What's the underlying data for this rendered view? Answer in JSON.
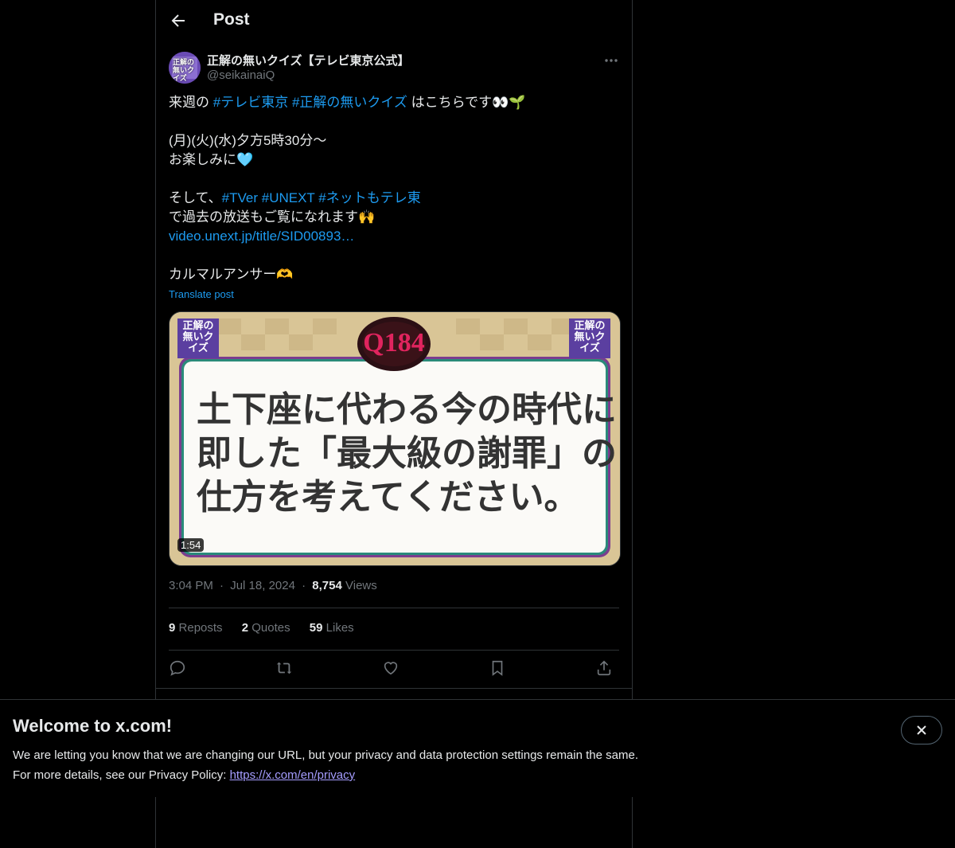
{
  "header": {
    "title": "Post"
  },
  "author": {
    "name": "正解の無いクイズ【テレビ東京公式】",
    "handle": "@seikainaiQ",
    "avatar_text": "正解の無いクイズ"
  },
  "post": {
    "lines": [
      [
        {
          "t": "来週の "
        },
        {
          "t": "#テレビ東京",
          "link": true
        },
        {
          "t": " "
        },
        {
          "t": "#正解の無いクイズ",
          "link": true
        },
        {
          "t": " はこちらです👀🌱"
        }
      ],
      [],
      [
        {
          "t": "(月)(火)(水)夕方5時30分〜"
        }
      ],
      [
        {
          "t": "お楽しみに🩵"
        }
      ],
      [],
      [
        {
          "t": "そして、"
        },
        {
          "t": "#TVer",
          "link": true
        },
        {
          "t": " "
        },
        {
          "t": "#UNEXT",
          "link": true
        },
        {
          "t": " "
        },
        {
          "t": "#ネットもテレ東",
          "link": true
        }
      ],
      [
        {
          "t": "で過去の放送もご覧になれます🙌"
        }
      ],
      [
        {
          "t": "video.unext.jp/title/SID00893…",
          "link": true
        }
      ],
      [],
      [
        {
          "t": "カルマルアンサー🫶"
        }
      ]
    ],
    "translate": "Translate post"
  },
  "media": {
    "q_label": "Q184",
    "logo": "正解の無いクイズ",
    "question_lines": [
      "土下座に代わる今の時代に",
      "即した「最大級の謝罪」の",
      "仕方を考えてください。"
    ],
    "duration": "1:54"
  },
  "meta": {
    "time": "3:04 PM",
    "sep": "·",
    "date": "Jul 18, 2024",
    "views_count": "8,754",
    "views_label": "Views"
  },
  "stats": {
    "reposts_count": "9",
    "reposts_label": "Reposts",
    "quotes_count": "2",
    "quotes_label": "Quotes",
    "likes_count": "59",
    "likes_label": "Likes"
  },
  "banner": {
    "title": "Welcome to x.com!",
    "line1": "We are letting you know that we are changing our URL, but your privacy and data protection settings remain the same.",
    "line2_prefix": "For more details, see our Privacy Policy: ",
    "link": "https://x.com/en/privacy"
  },
  "icons": [
    "back-arrow-icon",
    "more-icon",
    "reply-icon",
    "repost-icon",
    "like-icon",
    "bookmark-icon",
    "share-icon",
    "close-icon"
  ],
  "colors": {
    "link": "#1d9bf0",
    "text": "#e7e9ea",
    "muted": "#71767b",
    "border": "#2f3336"
  }
}
